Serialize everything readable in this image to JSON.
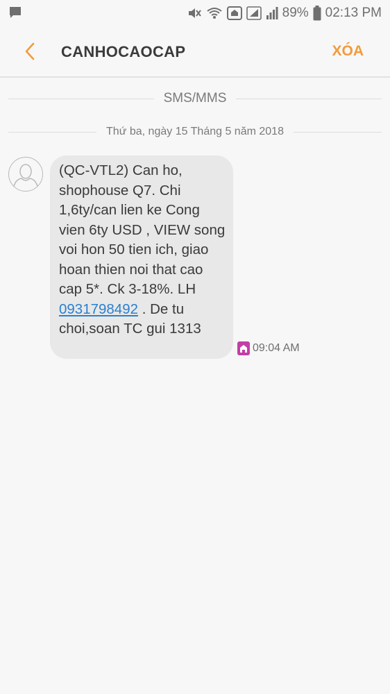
{
  "status_bar": {
    "battery": "89%",
    "time": "02:13 PM"
  },
  "header": {
    "title": "CANHOCAOCAP",
    "delete_label": "XÓA"
  },
  "conversation": {
    "channel_label": "SMS/MMS",
    "date_label": "Thứ ba, ngày 15 Tháng 5 năm 2018",
    "messages": [
      {
        "text_before": "(QC-VTL2) Can ho, shophouse Q7. Chi 1,6ty/can lien ke Cong vien 6ty USD , VIEW song voi hon 50 tien ich, giao hoan thien noi that cao cap 5*. Ck 3-18%. LH ",
        "phone_link": "0931798492",
        "text_after": " . De tu choi,soan TC gui 1313",
        "time": "09:04 AM"
      }
    ]
  },
  "colors": {
    "accent": "#f39b3a",
    "bubble": "#e8e8e8",
    "link": "#2a7fd0",
    "sim_badge": "#c23fa7"
  }
}
